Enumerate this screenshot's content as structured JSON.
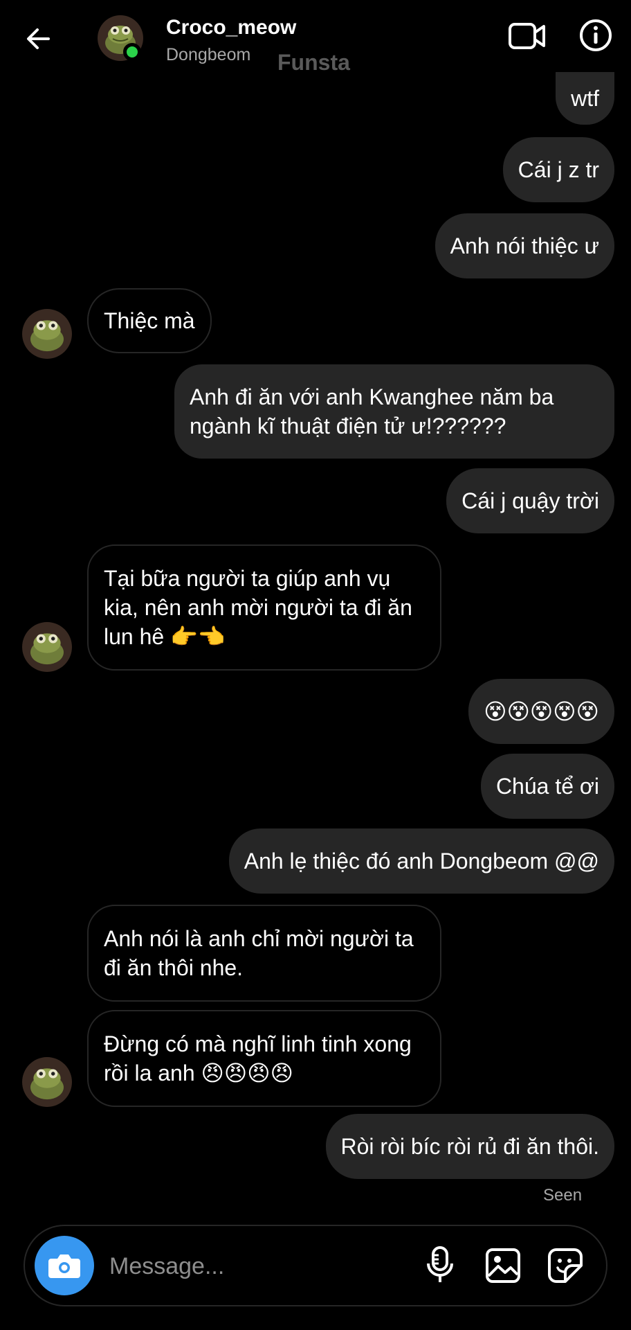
{
  "header": {
    "name": "Croco_meow",
    "subtitle": "Dongbeom",
    "account_label": "Funsta",
    "back_icon": "arrow-left-icon",
    "video_icon": "video-call-icon",
    "info_icon": "info-icon",
    "online_color": "#2bd24a"
  },
  "messages": [
    {
      "from": "me",
      "text": "wtf"
    },
    {
      "from": "me",
      "text": "Cái j z tr"
    },
    {
      "from": "me",
      "text": "Anh nói thiệc ư"
    },
    {
      "from": "them",
      "text": "Thiệc mà"
    },
    {
      "from": "me",
      "text": "Anh đi ăn với anh Kwanghee năm ba ngành kĩ thuật điện tử ư!??????"
    },
    {
      "from": "me",
      "text": "Cái j quậy trời"
    },
    {
      "from": "them",
      "text": "Tại bữa người ta giúp anh vụ kia, nên anh mời người ta đi ăn lun hê 👉👈"
    },
    {
      "from": "me",
      "text": "😵😵😵😵😵"
    },
    {
      "from": "me",
      "text": "Chúa tể ơi"
    },
    {
      "from": "me",
      "text": "Anh lẹ thiệc đó anh Dongbeom @@"
    },
    {
      "from": "them",
      "text": "Anh nói là anh chỉ mời người ta đi ăn thôi nhe."
    },
    {
      "from": "them",
      "text": "Đừng có mà nghĩ linh tinh xong rồi la anh 😠😠😠😠"
    },
    {
      "from": "me",
      "text": "Ròi ròi bíc ròi rủ đi ăn thôi."
    }
  ],
  "status": {
    "seen": "Seen"
  },
  "composer": {
    "placeholder": "Message...",
    "camera_icon": "camera-icon",
    "mic_icon": "microphone-icon",
    "image_icon": "gallery-icon",
    "sticker_icon": "sticker-icon",
    "accent": "#3797f0"
  },
  "colors": {
    "background": "#000000",
    "my_bubble": "#262626",
    "secondary_text": "#a8a8a8"
  }
}
